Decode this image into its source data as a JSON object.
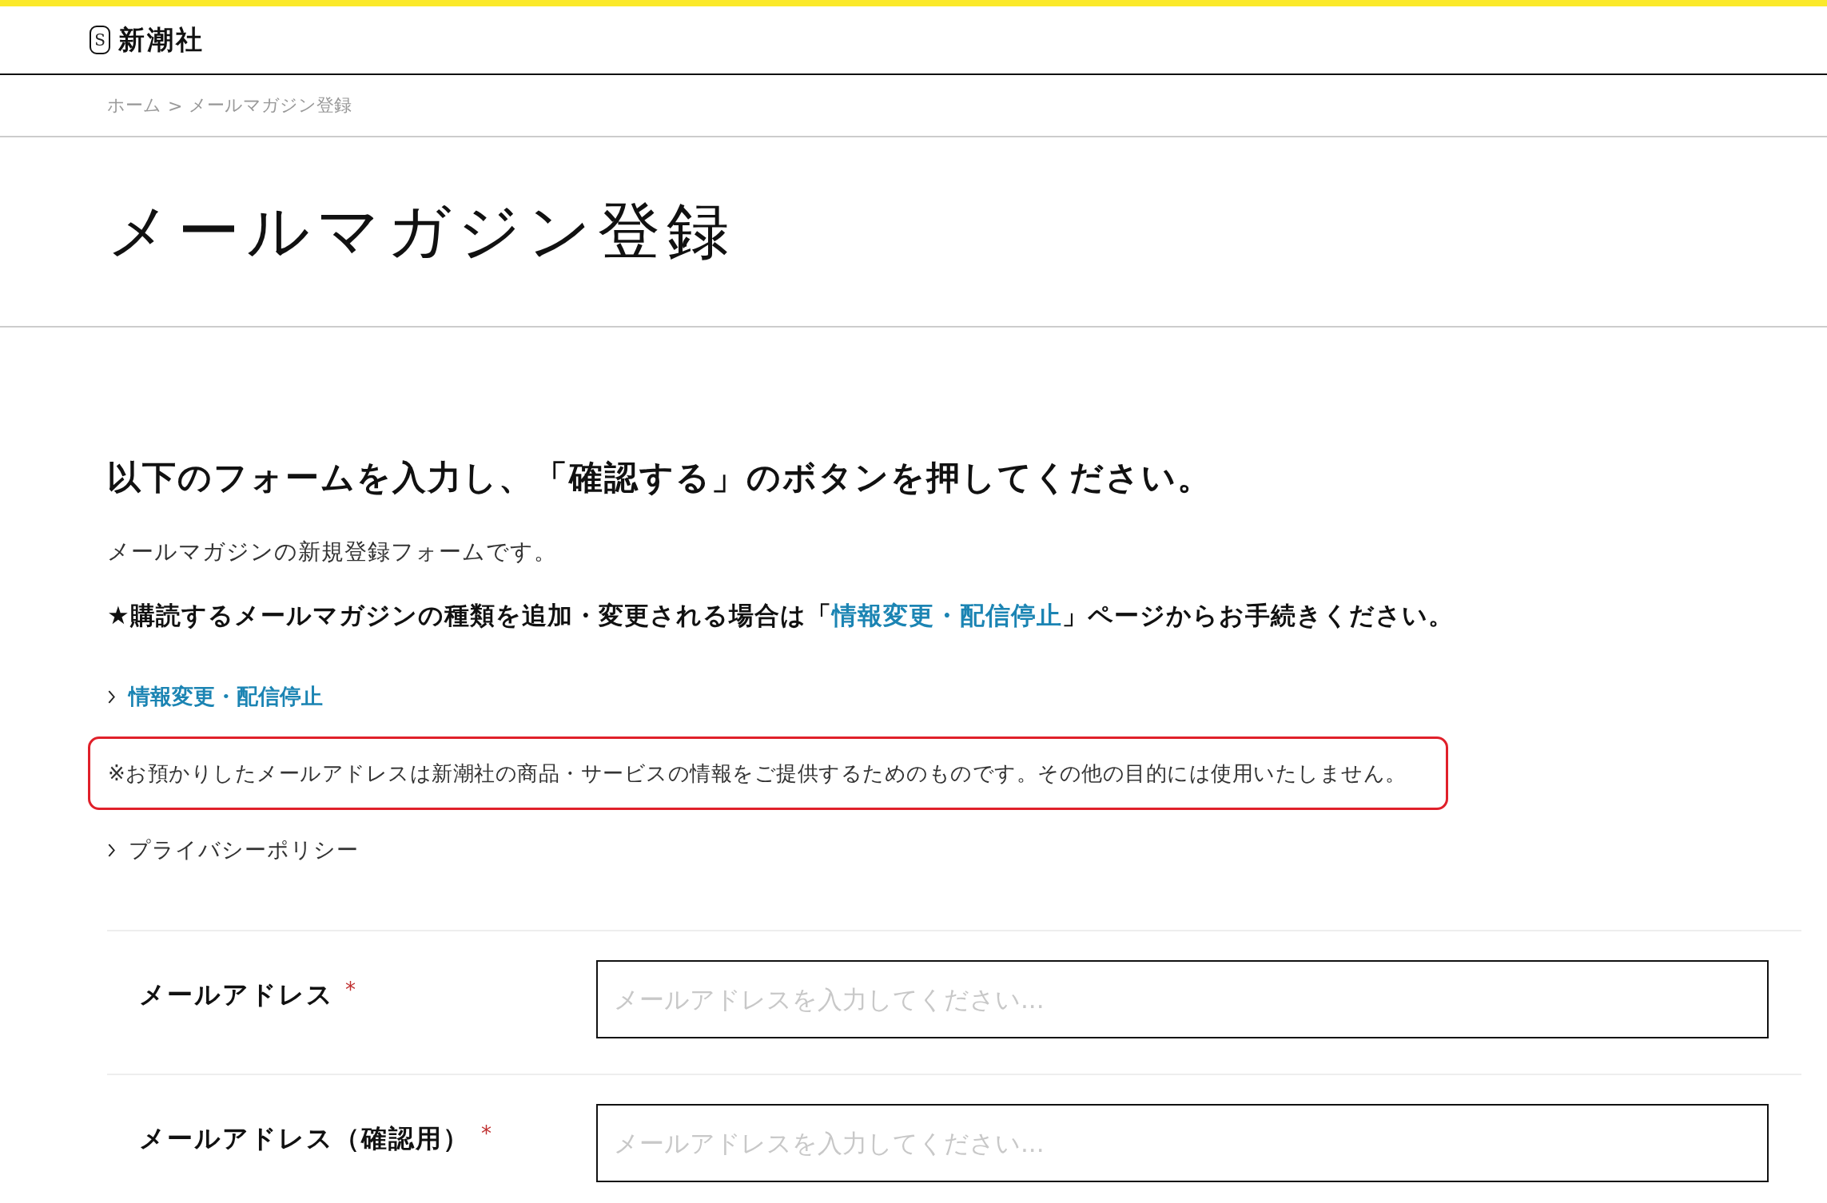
{
  "header": {
    "logo_mark": "S",
    "logo_text": "新潮社"
  },
  "breadcrumb": [
    "ホーム",
    ">",
    "メールマガジン登録"
  ],
  "page_title": "メールマガジン登録",
  "instruction": "以下のフォームを入力し、「確認する」のボタンを押してください。",
  "intro": "メールマガジンの新規登録フォームです。",
  "notice": {
    "before": "★購読するメールマガジンの種類を追加・変更される場合は「",
    "link": "情報変更・配信停止",
    "after": "」ページからお手続きください。"
  },
  "change_link": "情報変更・配信停止",
  "privacy_note": "※お預かりしたメールアドレスは新潮社の商品・サービスの情報をご提供するためのものです。その他の目的には使用いたしません。",
  "privacy_link": "プライバシーポリシー",
  "fields": [
    {
      "label": "メールアドレス",
      "required_mark": "*",
      "placeholder": "メールアドレスを入力してください..."
    },
    {
      "label": "メールアドレス（確認用）",
      "required_mark": "*",
      "placeholder": "メールアドレスを入力してください..."
    }
  ]
}
